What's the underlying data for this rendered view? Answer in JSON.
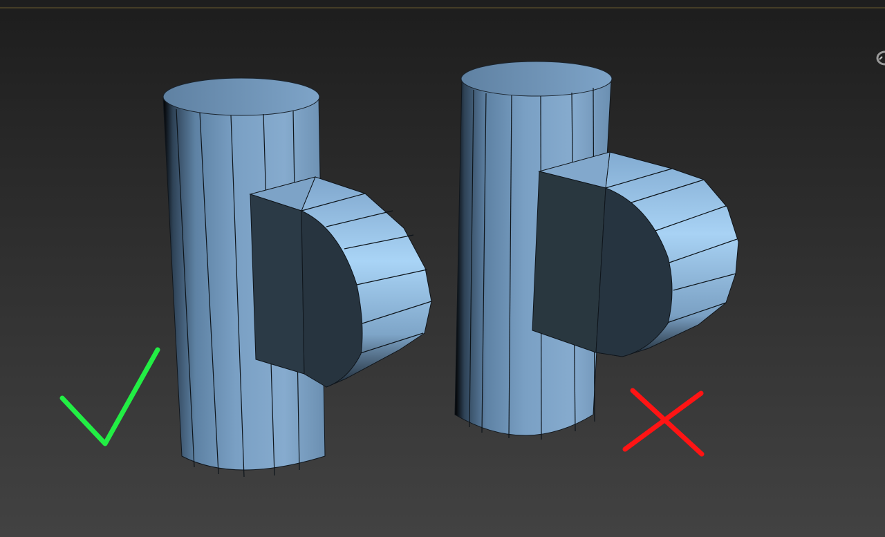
{
  "viewport": {
    "background_top": "#1d1d1d",
    "background_bottom": "#424242",
    "active_border_color": "#8f7636"
  },
  "models": [
    {
      "name": "cylinder-with-extrusion-correct",
      "result": "correct",
      "mesh_color": "#6d96bc"
    },
    {
      "name": "cylinder-with-extrusion-incorrect",
      "result": "incorrect",
      "mesh_color": "#6d96bc"
    }
  ],
  "marks": {
    "correct": {
      "icon": "checkmark-icon",
      "color": "#22ee44"
    },
    "incorrect": {
      "icon": "cross-icon",
      "color": "#ff1414"
    }
  },
  "icons": {
    "view_cube": "viewcube-icon"
  }
}
